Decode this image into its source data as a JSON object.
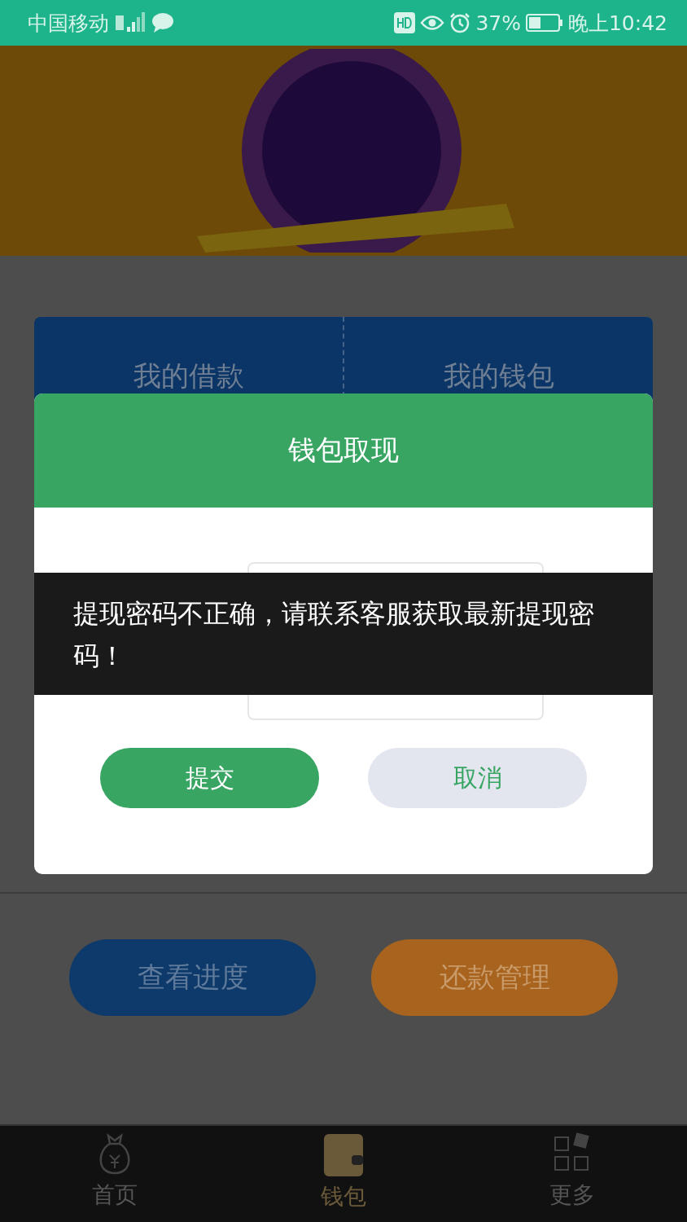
{
  "status_bar": {
    "carrier": "中国移动",
    "battery": "37%",
    "time": "晚上10:42"
  },
  "card_tabs": [
    {
      "label": "我的借款"
    },
    {
      "label": "我的钱包"
    }
  ],
  "actions": [
    {
      "label": "查看进度",
      "kind": "blue"
    },
    {
      "label": "还款管理",
      "kind": "orange"
    }
  ],
  "bottom_nav": [
    {
      "label": "首页",
      "kind": "home",
      "selected": false
    },
    {
      "label": "钱包",
      "kind": "wallet",
      "selected": true
    },
    {
      "label": "更多",
      "kind": "more",
      "selected": false
    }
  ],
  "dialog": {
    "title": "钱包取现",
    "buttons": [
      {
        "label": "提交",
        "kind": "primary"
      },
      {
        "label": "取消",
        "kind": "secondary"
      }
    ]
  },
  "toast": {
    "message": "提现密码不正确，请联系客服获取最新提现密码！"
  }
}
